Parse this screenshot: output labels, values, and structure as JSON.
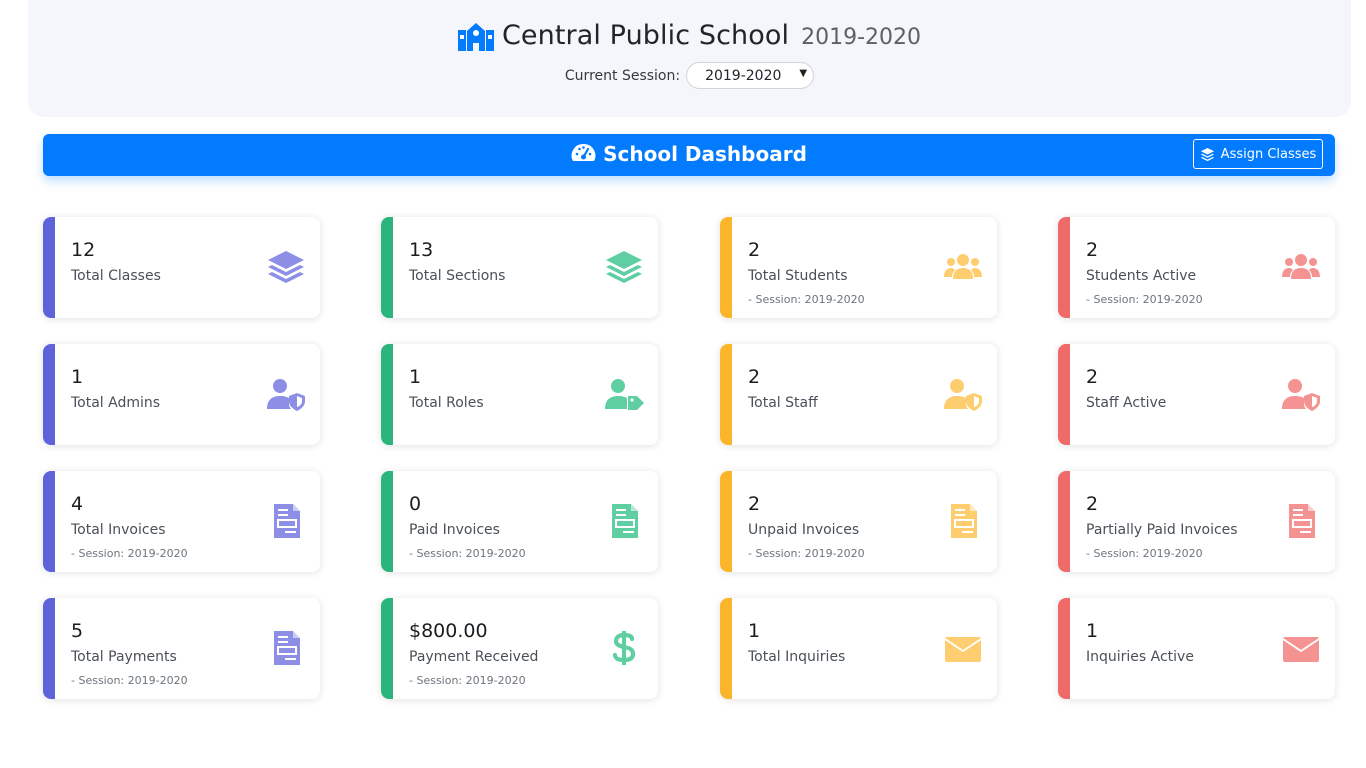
{
  "header": {
    "school_name": "Central Public School",
    "year": "2019-2020",
    "session_label": "Current Session:",
    "session_value": "2019-2020"
  },
  "dashboard": {
    "title": "School Dashboard",
    "assign_button": "Assign Classes"
  },
  "colors": {
    "primary": "#037bfe",
    "indigo": "#5f63d9",
    "green": "#2bb57c",
    "amber": "#fbb52a",
    "red": "#f06a6a"
  },
  "cards": [
    {
      "value": "12",
      "label": "Total Classes",
      "sub": "",
      "icon": "layers-icon"
    },
    {
      "value": "13",
      "label": "Total Sections",
      "sub": "",
      "icon": "layers-icon"
    },
    {
      "value": "2",
      "label": "Total Students",
      "sub": "- Session: 2019-2020",
      "icon": "users-icon"
    },
    {
      "value": "2",
      "label": "Students Active",
      "sub": "- Session: 2019-2020",
      "icon": "users-icon"
    },
    {
      "value": "1",
      "label": "Total Admins",
      "sub": "",
      "icon": "user-shield-icon"
    },
    {
      "value": "1",
      "label": "Total Roles",
      "sub": "",
      "icon": "user-tag-icon"
    },
    {
      "value": "2",
      "label": "Total Staff",
      "sub": "",
      "icon": "user-shield-icon"
    },
    {
      "value": "2",
      "label": "Staff Active",
      "sub": "",
      "icon": "user-shield-icon"
    },
    {
      "value": "4",
      "label": "Total Invoices",
      "sub": "- Session: 2019-2020",
      "icon": "invoice-icon"
    },
    {
      "value": "0",
      "label": "Paid Invoices",
      "sub": "- Session: 2019-2020",
      "icon": "invoice-icon"
    },
    {
      "value": "2",
      "label": "Unpaid Invoices",
      "sub": "- Session: 2019-2020",
      "icon": "invoice-icon"
    },
    {
      "value": "2",
      "label": "Partially Paid Invoices",
      "sub": "- Session: 2019-2020",
      "icon": "invoice-icon"
    },
    {
      "value": "5",
      "label": "Total Payments",
      "sub": "- Session: 2019-2020",
      "icon": "invoice-icon"
    },
    {
      "value": "$800.00",
      "label": "Payment Received",
      "sub": "- Session: 2019-2020",
      "icon": "dollar-icon"
    },
    {
      "value": "1",
      "label": "Total Inquiries",
      "sub": "",
      "icon": "envelope-icon"
    },
    {
      "value": "1",
      "label": "Inquiries Active",
      "sub": "",
      "icon": "envelope-icon"
    }
  ]
}
